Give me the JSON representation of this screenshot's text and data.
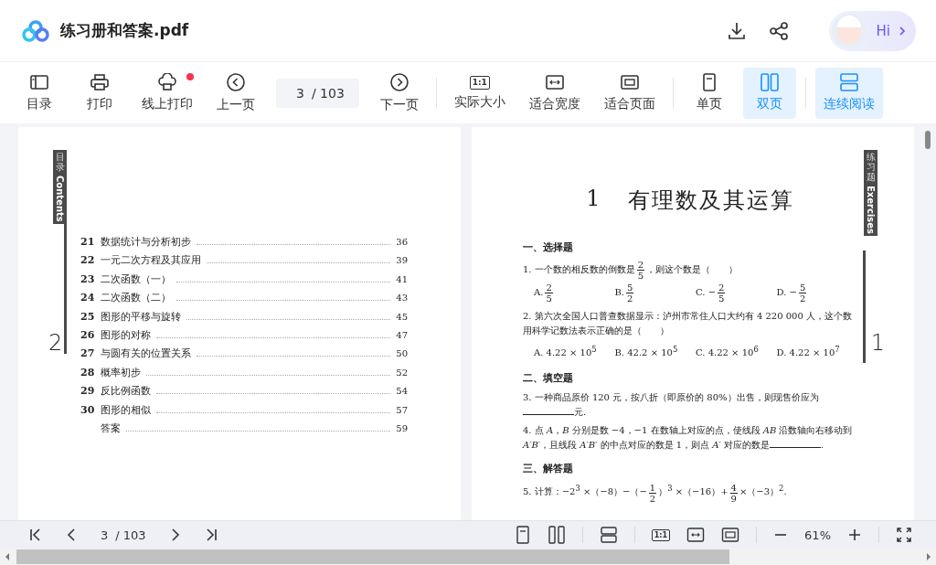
{
  "header": {
    "title": "练习册和答案.pdf",
    "greeting": "Hi"
  },
  "toolbar": {
    "groups": [
      [
        {
          "kind": "sidebar",
          "label": "目录",
          "selected": false,
          "badge": false
        },
        {
          "kind": "printer",
          "label": "打印",
          "selected": false,
          "badge": false
        },
        {
          "kind": "cloud-printer",
          "label": "线上打印",
          "selected": false,
          "badge": true
        },
        {
          "kind": "prev",
          "label": "上一页",
          "selected": false,
          "badge": false
        },
        {
          "kind": "field",
          "value": "3",
          "total": "/ 103"
        },
        {
          "kind": "next",
          "label": "下一页",
          "selected": false,
          "badge": false
        }
      ],
      [
        {
          "kind": "actual",
          "icon_text": "1:1",
          "label": "实际大小",
          "selected": false,
          "badge": false
        },
        {
          "kind": "fit-width",
          "label": "适合宽度",
          "selected": false,
          "badge": false
        },
        {
          "kind": "fit-page",
          "label": "适合页面",
          "selected": false,
          "badge": false
        }
      ],
      [
        {
          "kind": "single",
          "label": "单页",
          "selected": false,
          "badge": false
        },
        {
          "kind": "double",
          "label": "双页",
          "selected": true,
          "badge": false
        }
      ],
      [
        {
          "kind": "continuous",
          "label": "连续阅读",
          "selected": true,
          "badge": false
        }
      ]
    ]
  },
  "left_page": {
    "tab": {
      "chinese": "目录",
      "english": "Contents"
    },
    "page_number": "2",
    "toc": [
      {
        "number": "21",
        "title": "数据统计与分析初步",
        "page": "36"
      },
      {
        "number": "22",
        "title": "一元二次方程及其应用",
        "page": "39"
      },
      {
        "number": "23",
        "title": "二次函数（一）",
        "page": "41"
      },
      {
        "number": "24",
        "title": "二次函数（二）",
        "page": "43"
      },
      {
        "number": "25",
        "title": "图形的平移与旋转",
        "page": "45"
      },
      {
        "number": "26",
        "title": "图形的对称",
        "page": "47"
      },
      {
        "number": "27",
        "title": "与圆有关的位置关系",
        "page": "50"
      },
      {
        "number": "28",
        "title": "概率初步",
        "page": "52"
      },
      {
        "number": "29",
        "title": "反比例函数",
        "page": "54"
      },
      {
        "number": "30",
        "title": "图形的相似",
        "page": "57"
      },
      {
        "title": "答案",
        "page": "59"
      }
    ]
  },
  "right_page": {
    "tab": {
      "chinese": "练习题",
      "english": "Exercises"
    },
    "page_number": "1",
    "chapter_number": "1",
    "chapter_title": "有理数及其运算",
    "blocks": [
      {
        "kind": "heading",
        "text": "一、选择题"
      },
      {
        "kind": "question",
        "segments": [
          {
            "kind": "text",
            "text": "1. 一个数的相反数的倒数是"
          },
          {
            "kind": "frac",
            "num": "2",
            "den": "5"
          },
          {
            "kind": "text",
            "text": "，则这个数是（　　）"
          }
        ]
      },
      {
        "kind": "options",
        "options": [
          [
            {
              "kind": "text",
              "text": "A."
            },
            {
              "kind": "frac",
              "num": "2",
              "den": "5"
            }
          ],
          [
            {
              "kind": "text",
              "text": "B."
            },
            {
              "kind": "frac",
              "num": "5",
              "den": "2"
            }
          ],
          [
            {
              "kind": "text",
              "text": "C. −"
            },
            {
              "kind": "frac",
              "num": "2",
              "den": "5"
            }
          ],
          [
            {
              "kind": "text",
              "text": "D. −"
            },
            {
              "kind": "frac",
              "num": "5",
              "den": "2"
            }
          ]
        ]
      },
      {
        "kind": "question",
        "segments": [
          {
            "kind": "text",
            "text": "2. 第六次全国人口普查数据显示：泸州市常住人口大约有 4 220 000 人，这个数用科学记数法表示正确的是（　　）"
          }
        ]
      },
      {
        "kind": "options",
        "options": [
          [
            {
              "kind": "text",
              "text": "A. 4.22 × 10$^{5}$"
            }
          ],
          [
            {
              "kind": "text",
              "text": "B. 42.2 × 10$^{5}$"
            }
          ],
          [
            {
              "kind": "text",
              "text": "C. 4.22 × 10$^{6}$"
            }
          ],
          [
            {
              "kind": "text",
              "text": "D. 4.22 × 10$^{7}$"
            }
          ]
        ]
      },
      {
        "kind": "heading",
        "text": "二、填空题"
      },
      {
        "kind": "question",
        "segments": [
          {
            "kind": "text",
            "text": "3. 一种商品原价 120 元，按八折（即原价的 80%）出售，则现售价应为"
          },
          {
            "kind": "blank"
          },
          {
            "kind": "text",
            "text": "元."
          }
        ]
      },
      {
        "kind": "question",
        "segments": [
          {
            "kind": "text",
            "text": "4. 点 *A*，*B* 分别是数 −4，−1 在数轴上对应的点，使线段 *AB* 沿数轴向右移动到 *A′B′*，且线段 *A′B′* 的中点对应的数是 1，则点 *A′* 对应的数是"
          },
          {
            "kind": "blank"
          },
          {
            "kind": "text",
            "text": "."
          }
        ]
      },
      {
        "kind": "heading",
        "text": "三、解答题"
      },
      {
        "kind": "question",
        "segments": [
          {
            "kind": "text",
            "text": "5. 计算：−2$^{3}$ ×（−8）−（−"
          },
          {
            "kind": "frac",
            "num": "1",
            "den": "2"
          },
          {
            "kind": "text",
            "text": "）$^{3}$ ×（−16）+"
          },
          {
            "kind": "frac",
            "num": "4",
            "den": "9"
          },
          {
            "kind": "text",
            "text": "×（−3）$^{2}$."
          }
        ]
      }
    ]
  },
  "bottom_bar": {
    "page_value": "3",
    "page_total": "/ 103",
    "actual_icon_text": "1:1",
    "zoom": "61%"
  }
}
